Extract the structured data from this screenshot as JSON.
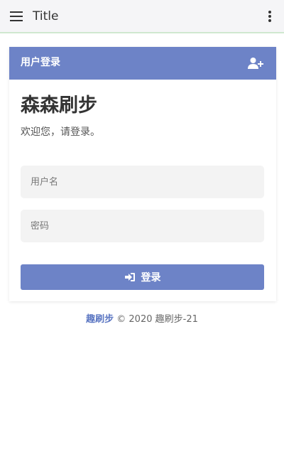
{
  "appbar": {
    "title": "Title",
    "menu_icon": "menu-icon",
    "more_icon": "more-vert-icon"
  },
  "card": {
    "header_title": "用户登录",
    "header_icon": "user-add-icon",
    "brand": "森森刷步",
    "welcome": "欢迎您，请登录。",
    "username_placeholder": "用户名",
    "password_placeholder": "密码",
    "login_label": "登录",
    "login_icon": "sign-in-icon"
  },
  "footer": {
    "link_text": "趣刷步",
    "copyright": " © 2020 趣刷步-21"
  },
  "colors": {
    "accent": "#6d83c7",
    "appbar_bg": "#f5f5f7",
    "field_bg": "#f3f3f3",
    "link": "#5b76c2"
  }
}
